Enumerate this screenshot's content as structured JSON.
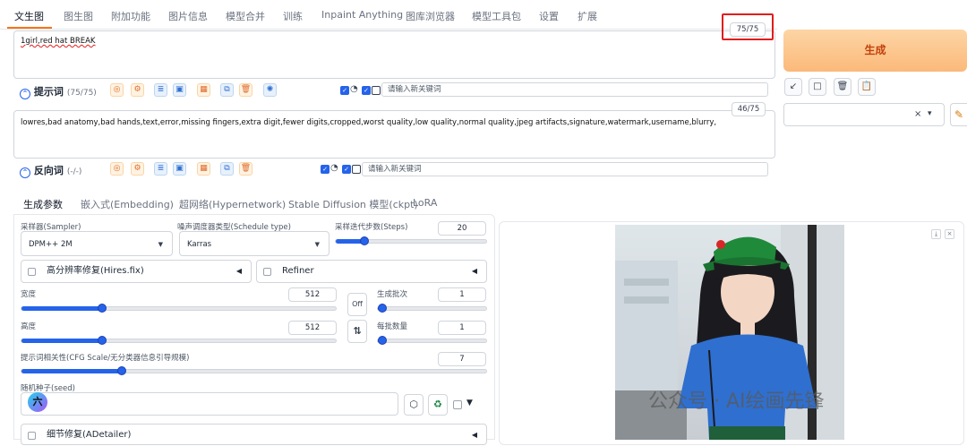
{
  "tabs": [
    "文生图",
    "图生图",
    "附加功能",
    "图片信息",
    "模型合并",
    "训练",
    "Inpaint Anything",
    "图库浏览器",
    "模型工具包",
    "设置",
    "扩展"
  ],
  "prompt": {
    "text": "1girl,red hat BREAK",
    "counter": "75/75",
    "label": "提示词",
    "count_label": "(75/75)",
    "keyword_placeholder": "请输入新关键词"
  },
  "negative": {
    "text": "lowres,bad anatomy,bad hands,text,error,missing fingers,extra digit,fewer digits,cropped,worst quality,low quality,normal quality,jpeg artifacts,signature,watermark,username,blurry,",
    "counter": "46/75",
    "label": "反向词",
    "count_label": "(-/-)",
    "keyword_placeholder": "请输入新关键词"
  },
  "generate_label": "生成",
  "tool_buttons": [
    "↙",
    "□",
    "🗑",
    "📋"
  ],
  "style_select": {
    "clear": "×",
    "arrow": "▾"
  },
  "subtabs": [
    "生成参数",
    "嵌入式(Embedding)",
    "超网络(Hypernetwork)",
    "Stable Diffusion 模型(ckpt)",
    "LoRA"
  ],
  "params": {
    "sampler_label": "采样器(Sampler)",
    "sampler_value": "DPM++ 2M",
    "schedule_label": "噪声调度器类型(Schedule type)",
    "schedule_value": "Karras",
    "steps_label": "采样迭代步数(Steps)",
    "steps_value": "20",
    "steps_level": 0.17,
    "hires_label": "高分辨率修复(Hires.fix)",
    "refiner_label": "Refiner",
    "width_label": "宽度",
    "width_value": "512",
    "width_level": 0.25,
    "height_label": "高度",
    "height_value": "512",
    "height_level": 0.25,
    "swap_off": "Off",
    "swap_icon": "⇅",
    "batch_count_label": "生成批次",
    "batch_count_value": "1",
    "batch_count_level": 0.0,
    "batch_size_label": "每批数量",
    "batch_size_value": "1",
    "batch_size_level": 0.0,
    "cfg_label": "提示词相关性(CFG Scale/无分类器信息引导规模)",
    "cfg_value": "7",
    "cfg_level": 0.21,
    "seed_label": "随机种子(seed)",
    "adetailer_label": "细节修复(ADetailer)"
  },
  "avatar_char": "六",
  "watermark_text": "公众号 · AI绘画先锋",
  "colors": {
    "accent": "#f97316",
    "slider": "#2563eb",
    "highlight": "#e11d1d"
  }
}
